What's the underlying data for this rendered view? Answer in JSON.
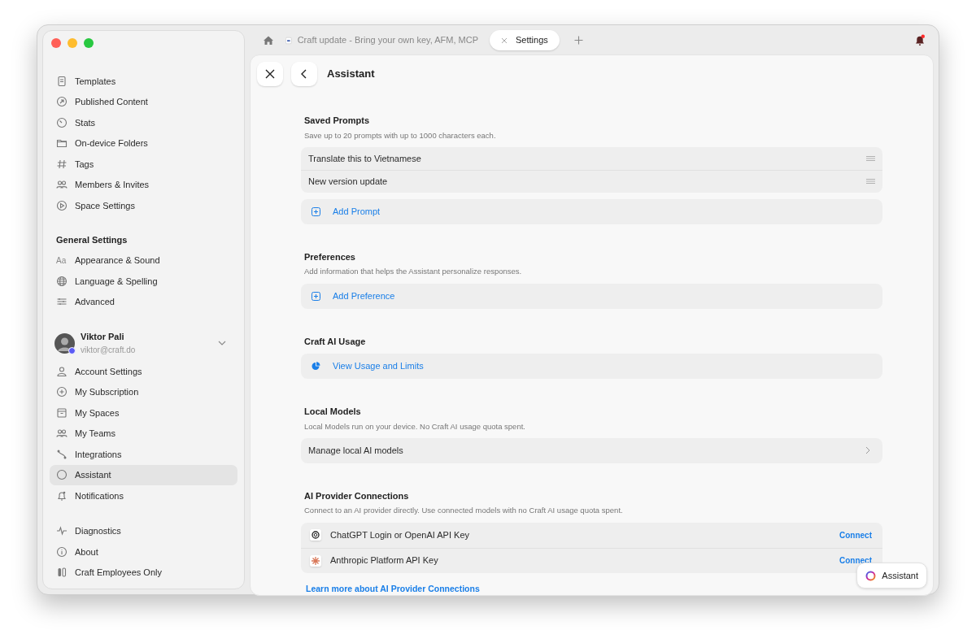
{
  "tabs": [
    {
      "label": "Craft update - Bring your own key, AFM, MCP",
      "selected": false
    },
    {
      "label": "Settings",
      "selected": true
    }
  ],
  "sidebar": {
    "groups": [
      {
        "items": [
          {
            "label": "Templates",
            "selected": false
          },
          {
            "label": "Published Content",
            "selected": false
          },
          {
            "label": "Stats",
            "selected": false
          },
          {
            "label": "On-device Folders",
            "selected": false
          },
          {
            "label": "Tags",
            "selected": false
          },
          {
            "label": "Members & Invites",
            "selected": false
          },
          {
            "label": "Space Settings",
            "selected": false
          }
        ]
      },
      {
        "heading": "General Settings",
        "items": [
          {
            "label": "Appearance & Sound",
            "selected": false,
            "glyph": "Aa"
          },
          {
            "label": "Language & Spelling",
            "selected": false
          },
          {
            "label": "Advanced",
            "selected": false
          }
        ]
      },
      {
        "profile": {
          "name": "Viktor Pali",
          "email": "viktor@craft.do"
        },
        "items": [
          {
            "label": "Account Settings",
            "selected": false
          },
          {
            "label": "My Subscription",
            "selected": false
          },
          {
            "label": "My Spaces",
            "selected": false
          },
          {
            "label": "My Teams",
            "selected": false
          },
          {
            "label": "Integrations",
            "selected": false
          },
          {
            "label": "Assistant",
            "selected": true
          },
          {
            "label": "Notifications",
            "selected": false
          }
        ]
      },
      {
        "items": [
          {
            "label": "Diagnostics",
            "selected": false
          },
          {
            "label": "About",
            "selected": false
          },
          {
            "label": "Craft Employees Only",
            "selected": false
          }
        ]
      }
    ]
  },
  "page": {
    "title": "Assistant",
    "sections": [
      {
        "title": "Saved Prompts",
        "subtitle": "Save up to 20 prompts with up to 1000 characters each.",
        "cards": [
          [
            {
              "kind": "prompt",
              "label": "Translate this to Vietnamese"
            },
            {
              "kind": "prompt",
              "label": "New version update"
            }
          ],
          [
            {
              "kind": "add",
              "label": "Add Prompt"
            }
          ]
        ]
      },
      {
        "title": "Preferences",
        "subtitle": "Add information that helps the Assistant personalize responses.",
        "cards": [
          [
            {
              "kind": "add",
              "label": "Add Preference"
            }
          ]
        ]
      },
      {
        "title": "Craft AI Usage",
        "cards": [
          [
            {
              "kind": "usage",
              "label": "View Usage and Limits"
            }
          ]
        ]
      },
      {
        "title": "Local Models",
        "subtitle": "Local Models run on your device. No Craft AI usage quota spent.",
        "cards": [
          [
            {
              "kind": "nav",
              "label": "Manage local AI models"
            }
          ]
        ]
      },
      {
        "title": "AI Provider Connections",
        "subtitle": "Connect to an AI provider directly. Use connected models with no Craft AI usage quota spent.",
        "cards": [
          [
            {
              "kind": "provider",
              "label": "ChatGPT Login or OpenAI API Key",
              "action": "Connect"
            },
            {
              "kind": "provider",
              "label": "Anthropic Platform API Key",
              "action": "Connect"
            }
          ]
        ]
      }
    ],
    "footer_link": "Learn more about AI Provider Connections"
  },
  "assistant_button": "Assistant"
}
